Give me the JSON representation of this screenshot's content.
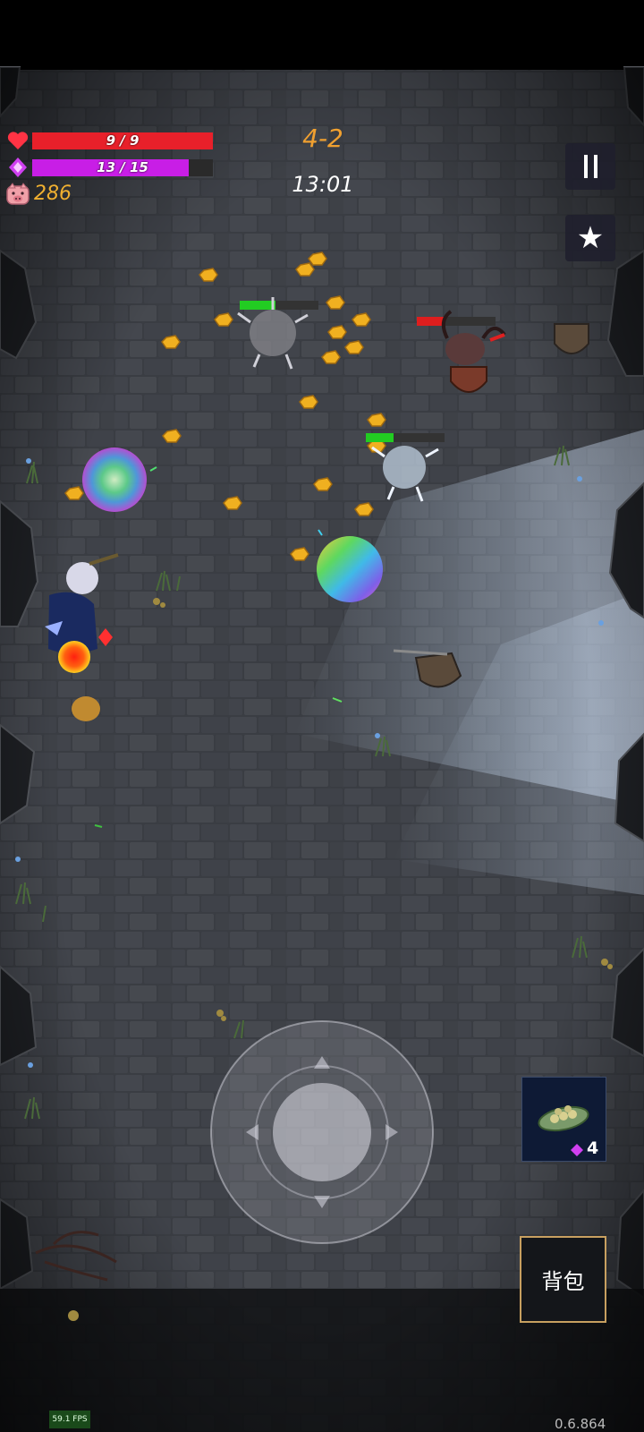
{
  "hud": {
    "hp_text": "9 / 9",
    "hp_fraction": 1.0,
    "mp_text": "13 / 15",
    "mp_fraction": 0.867,
    "coins": "286",
    "stage": "4-2",
    "timer": "13:01",
    "hp_color": "#e8202a",
    "mp_color": "#c81ee6",
    "stage_color": "#f0a030"
  },
  "buttons": {
    "pause_icon": "pause-icon",
    "star_icon": "star-icon",
    "backpack_label": "背包"
  },
  "item_slot": {
    "icon": "bean-pod-icon",
    "count": "4"
  },
  "footer": {
    "fps": "59.1 FPS",
    "version": "0.6.864"
  },
  "enemies": [
    {
      "name": "spiky-ghost-1",
      "health_fraction": 0.45
    },
    {
      "name": "demon-warrior",
      "health_fraction": 0.35
    },
    {
      "name": "spiky-ghost-2",
      "health_fraction": 0.35
    }
  ]
}
